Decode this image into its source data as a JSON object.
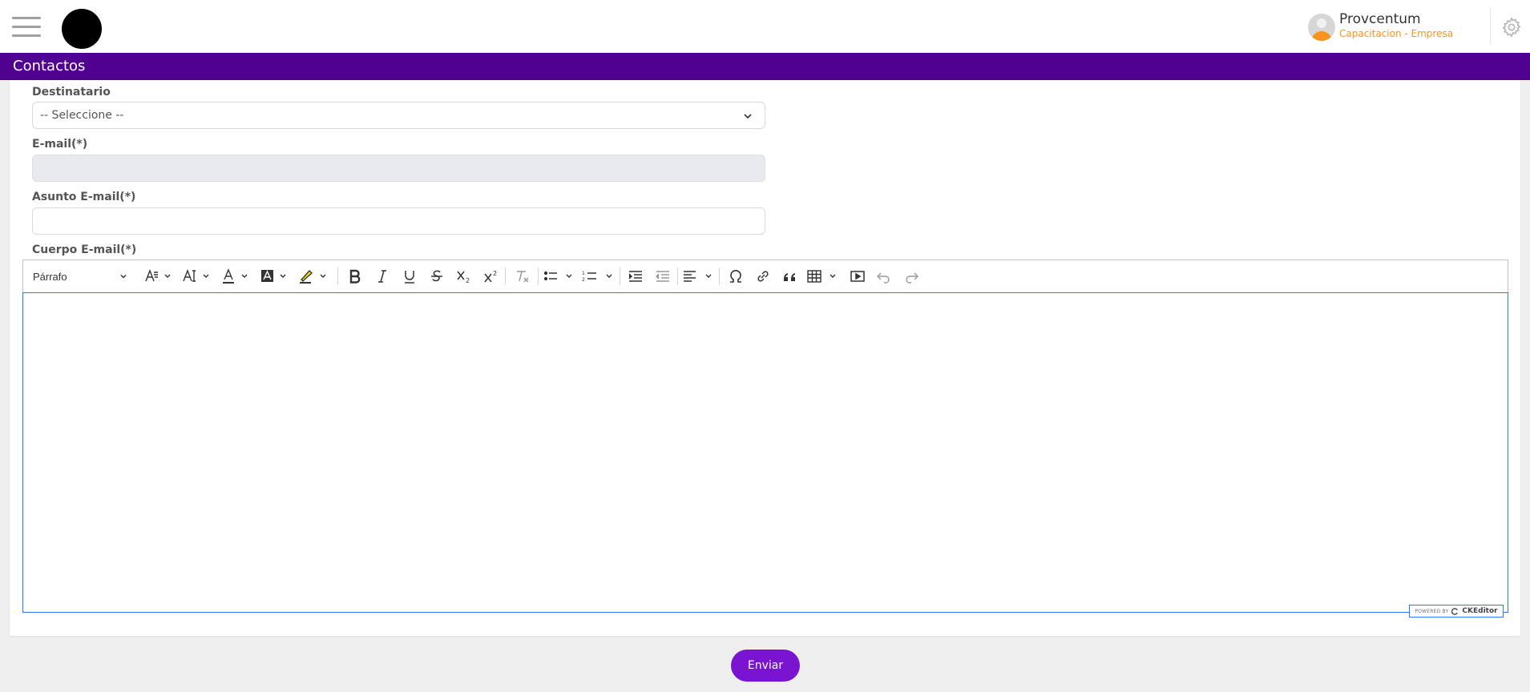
{
  "header": {
    "user_name": "Provcentum",
    "user_org": "Capacitacion - Empresa"
  },
  "page": {
    "title": "Contactos"
  },
  "form": {
    "recipient_label": "Destinatario",
    "recipient_value": "-- Seleccione --",
    "email_label": "E-mail(*)",
    "email_value": "",
    "subject_label": "Asunto E-mail(*)",
    "subject_value": "",
    "body_label": "Cuerpo E-mail(*)"
  },
  "editor": {
    "paragraph_style": "Párrafo",
    "powered_by": "POWERED BY",
    "brand": "CKEditor",
    "tools": [
      "font-size-icon",
      "font-family-icon",
      "font-color-icon",
      "background-color-icon",
      "highlight-icon",
      "bold-icon",
      "italic-icon",
      "underline-icon",
      "strikethrough-icon",
      "subscript-icon",
      "superscript-icon",
      "remove-format-icon",
      "bulleted-list-icon",
      "numbered-list-icon",
      "indent-icon",
      "outdent-icon",
      "align-icon",
      "special-characters-icon",
      "link-icon",
      "blockquote-icon",
      "table-icon",
      "media-icon",
      "undo-icon",
      "redo-icon"
    ]
  },
  "actions": {
    "send_label": "Enviar"
  },
  "colors": {
    "title_bar": "#510190",
    "send_button": "#7a14d0",
    "accent_text": "#f7941d",
    "editor_focus": "#2977ff"
  }
}
